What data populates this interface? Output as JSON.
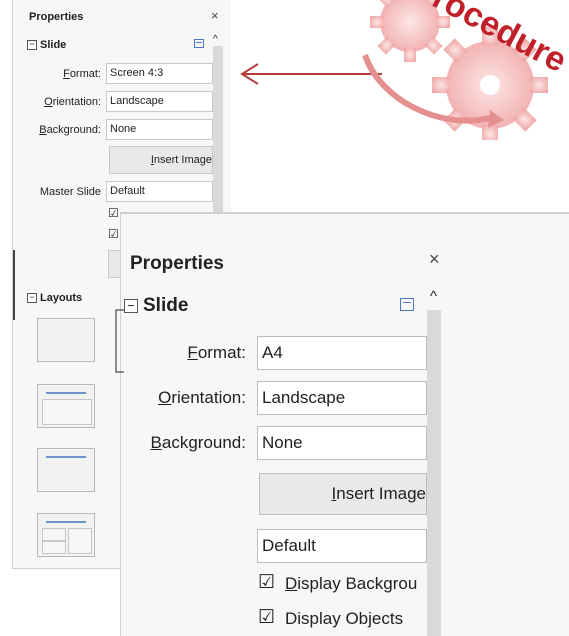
{
  "small_panel": {
    "title": "Properties",
    "close": "×",
    "section_slide": "Slide",
    "format_label_pre": "",
    "format_label_mn": "F",
    "format_label_post": "ormat:",
    "format_value": "Screen 4:3",
    "orientation_label_mn": "O",
    "orientation_label_post": "rientation:",
    "orientation_value": "Landscape",
    "background_label_mn": "B",
    "background_label_post": "ackground:",
    "background_value": "None",
    "insert_image_mn": "I",
    "insert_image_post": "nsert Image",
    "master_slide_label": "Master Slide",
    "master_slide_value": "Default",
    "section_layouts": "Layouts"
  },
  "large_panel": {
    "title": "Properties",
    "close": "×",
    "section_slide": "Slide",
    "format_label_mn": "F",
    "format_label_post": "ormat:",
    "format_value": "A4",
    "orientation_label_mn": "O",
    "orientation_label_post": "rientation:",
    "orientation_value": "Landscape",
    "background_label_mn": "B",
    "background_label_post": "ackground:",
    "background_value": "None",
    "insert_image_mn": "I",
    "insert_image_post": "nsert Image",
    "master_slide_value": "Default",
    "display_background_mn": "D",
    "display_background_post": "isplay Backgrou",
    "display_objects": "Display Objects"
  },
  "procedure_graphic": {
    "text": "Procedure",
    "color": "#c0202a",
    "gear_color": "#f4c6c6"
  },
  "colors": {
    "arrow": "#b53a3a",
    "layout_line": "#6d93c8"
  }
}
